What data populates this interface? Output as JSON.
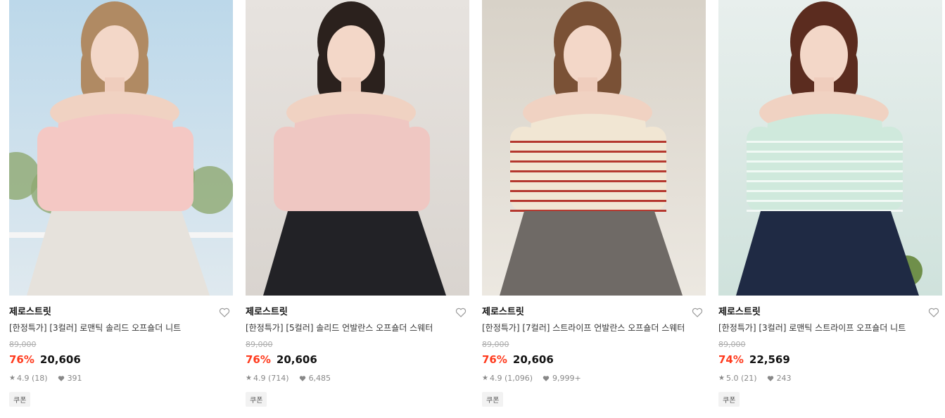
{
  "products": [
    {
      "brand": "제로스트릿",
      "title": "[한정특가] [3컬러] 로맨틱 솔리드 오프숄더 니트",
      "original_price": "89,000",
      "discount": "76%",
      "price": "20,606",
      "rating": "4.9",
      "reviews": "(18)",
      "likes": "391",
      "badge": "쿠폰",
      "image": {
        "bg_top": "#bcd8ea",
        "bg_bottom": "#dfe9ef",
        "top_color": "#f4c8c4",
        "bottom_color": "#e6e2dc",
        "hair": "#b08a63",
        "accent": "#8fa970"
      }
    },
    {
      "brand": "제로스트릿",
      "title": "[한정특가] [5컬러] 솔리드 언발란스 오프숄더 스웨터",
      "original_price": "89,000",
      "discount": "76%",
      "price": "20,606",
      "rating": "4.9",
      "reviews": "(714)",
      "likes": "6,485",
      "badge": "쿠폰",
      "image": {
        "bg_top": "#e7e3df",
        "bg_bottom": "#d9d4cf",
        "top_color": "#efc7c2",
        "bottom_color": "#222226",
        "hair": "#2b211d",
        "accent": "#cbc4bd"
      }
    },
    {
      "brand": "제로스트릿",
      "title": "[한정특가] [7컬러] 스트라이프 언발란스 오프숄더 스웨터",
      "original_price": "89,000",
      "discount": "76%",
      "price": "20,606",
      "rating": "4.9",
      "reviews": "(1,096)",
      "likes": "9,999+",
      "badge": "쿠폰",
      "image": {
        "bg_top": "#d8d2c8",
        "bg_bottom": "#ece8e1",
        "top_color": "#f1e6d3",
        "bottom_color": "#6f6a66",
        "hair": "#7a5136",
        "accent": "#b5392f"
      }
    },
    {
      "brand": "제로스트릿",
      "title": "[한정특가] [3컬러] 로맨틱 스트라이프 오프숄더 니트",
      "original_price": "89,000",
      "discount": "74%",
      "price": "22,569",
      "rating": "5.0",
      "reviews": "(21)",
      "likes": "243",
      "badge": "쿠폰",
      "image": {
        "bg_top": "#e8efed",
        "bg_bottom": "#cfe2dc",
        "top_color": "#cfe9dc",
        "bottom_color": "#1f2a44",
        "hair": "#5b2c1f",
        "accent": "#6f8f4a"
      }
    }
  ]
}
